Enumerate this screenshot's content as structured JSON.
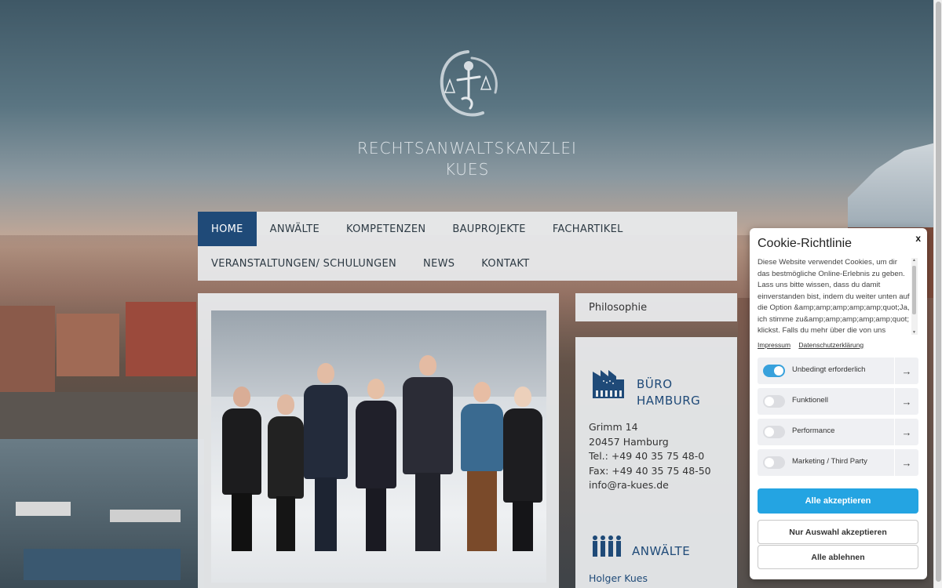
{
  "site": {
    "title_line1": "RECHTSANWALTSKANZLEI",
    "title_line2": "KUES"
  },
  "nav": {
    "row1": [
      "HOME",
      "ANWÄLTE",
      "KOMPETENZEN",
      "BAUPROJEKTE",
      "FACHARTIKEL"
    ],
    "row2": [
      "VERANSTALTUNGEN/ SCHULUNGEN",
      "NEWS",
      "KONTAKT"
    ],
    "active": "HOME"
  },
  "sidebar": {
    "tab_label": "Philosophie",
    "office": {
      "title_line1": "BÜRO",
      "title_line2": "HAMBURG",
      "street": "Grimm 14",
      "city": "20457 Hamburg",
      "phone": "Tel.: +49 40 35 75 48-0",
      "fax": "Fax: +49 40 35 75 48-50",
      "email": "info@ra-kues.de"
    },
    "lawyers": {
      "title": "ANWÄLTE",
      "first_name": "Holger Kues"
    }
  },
  "cookie": {
    "close": "x",
    "title": "Cookie-Richtlinie",
    "text": "Diese Website verwendet Cookies, um dir das bestmögliche Online-Erlebnis zu geben. Lass uns bitte wissen, dass du damit einverstanden bist, indem du weiter unten auf die Option &amp;amp;amp;amp;amp;quot;Ja, ich stimme zu&amp;amp;amp;amp;amp;quot; klickst. Falls du mehr über die von uns verwendeten Cookies",
    "link_impressum": "Impressum",
    "link_datenschutz": "Datenschutzerklärung",
    "toggles": [
      {
        "label": "Unbedingt erforderlich",
        "on": true
      },
      {
        "label": "Funktionell",
        "on": false
      },
      {
        "label": "Performance",
        "on": false
      },
      {
        "label": "Marketing / Third Party",
        "on": false
      }
    ],
    "btn_accept_all": "Alle akzeptieren",
    "btn_accept_selection": "Nur Auswahl akzeptieren",
    "btn_reject_all": "Alle ablehnen",
    "arrow": "→"
  },
  "colors": {
    "brand_blue": "#1f4a78",
    "accept_blue": "#24a4e2",
    "toggle_on": "#38a1dc"
  }
}
